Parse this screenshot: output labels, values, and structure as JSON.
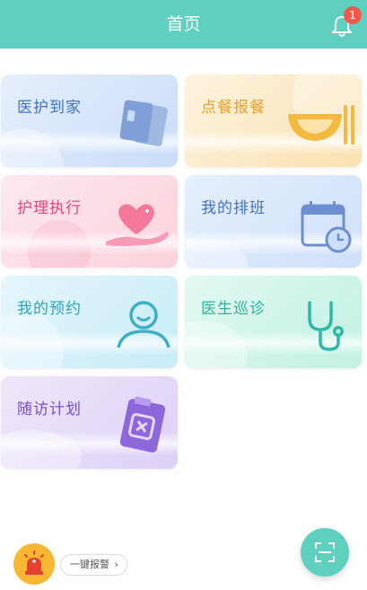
{
  "header": {
    "title": "首页",
    "notification_count": "1"
  },
  "cards": [
    {
      "label": "医护到家",
      "icon": "id-cards-icon"
    },
    {
      "label": "点餐报餐",
      "icon": "bowl-icon"
    },
    {
      "label": "护理执行",
      "icon": "heart-hand-icon"
    },
    {
      "label": "我的排班",
      "icon": "calendar-clock-icon"
    },
    {
      "label": "我的预约",
      "icon": "person-icon"
    },
    {
      "label": "医生巡诊",
      "icon": "stethoscope-icon"
    },
    {
      "label": "随访计划",
      "icon": "clipboard-icon"
    }
  ],
  "alarm": {
    "label": "一键报警",
    "chevron": "›"
  },
  "scan": {
    "icon": "scan-icon"
  },
  "colors": {
    "primary": "#5fcfc0",
    "badge": "#f2594b",
    "alarm": "#f7b733"
  }
}
